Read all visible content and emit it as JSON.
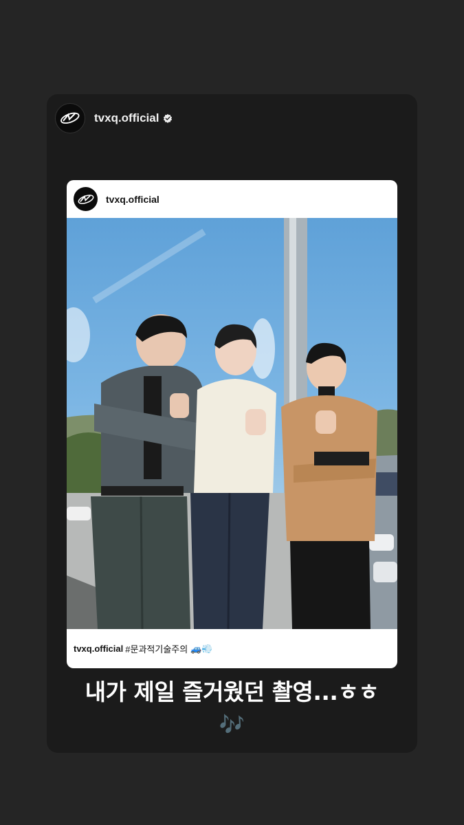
{
  "story": {
    "username": "tvxq.official",
    "avatar_icon": "tvxq-logo-icon",
    "verified_icon": "verified-badge-icon"
  },
  "shared_post": {
    "username": "tvxq.official",
    "avatar_icon": "tvxq-logo-icon",
    "photo_icon": "group-photo-three-men-thumbs-up",
    "caption_user": "tvxq.official",
    "caption_text": "#문과적기술주의",
    "caption_emojis": "🚙💨"
  },
  "overlay_text": "내가 제일 즐거웠던 촬영...ㅎㅎ",
  "overlay_emoji": "🎶",
  "colors": {
    "background": "#252525",
    "story_card": "#1b1b1b",
    "post_card": "#ffffff",
    "text_light": "#ffffff"
  }
}
